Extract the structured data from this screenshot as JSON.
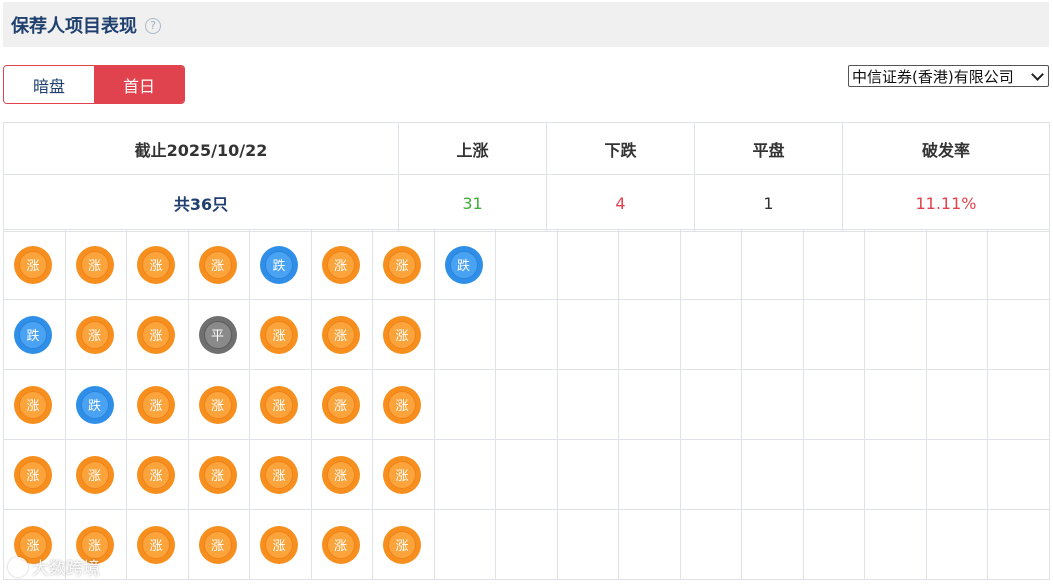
{
  "header": {
    "title": "保荐人项目表现",
    "help_icon": "?"
  },
  "toggle": {
    "options": [
      "暗盘",
      "首日"
    ],
    "active": "首日"
  },
  "broker": {
    "selected": "中信证券(香港)有限公司"
  },
  "summary": {
    "headers": [
      "截止2025/10/22",
      "上涨",
      "下跌",
      "平盘",
      "破发率"
    ],
    "total": "共36只",
    "up": "31",
    "down": "4",
    "flat": "1",
    "rate": "11.11%"
  },
  "grid": {
    "columns": 17,
    "rows": [
      [
        "涨",
        "涨",
        "涨",
        "涨",
        "跌",
        "涨",
        "涨",
        "跌"
      ],
      [
        "跌",
        "涨",
        "涨",
        "平",
        "涨",
        "涨",
        "涨"
      ],
      [
        "涨",
        "跌",
        "涨",
        "涨",
        "涨",
        "涨",
        "涨"
      ],
      [
        "涨",
        "涨",
        "涨",
        "涨",
        "涨",
        "涨",
        "涨"
      ],
      [
        "涨",
        "涨",
        "涨",
        "涨",
        "涨",
        "涨",
        "涨"
      ]
    ]
  },
  "colors": {
    "up": "#f78f1e",
    "down": "#2f8fe8",
    "flat": "#6f6f6f",
    "accent": "#e0434e"
  },
  "watermark": {
    "text": "大数跨境"
  }
}
